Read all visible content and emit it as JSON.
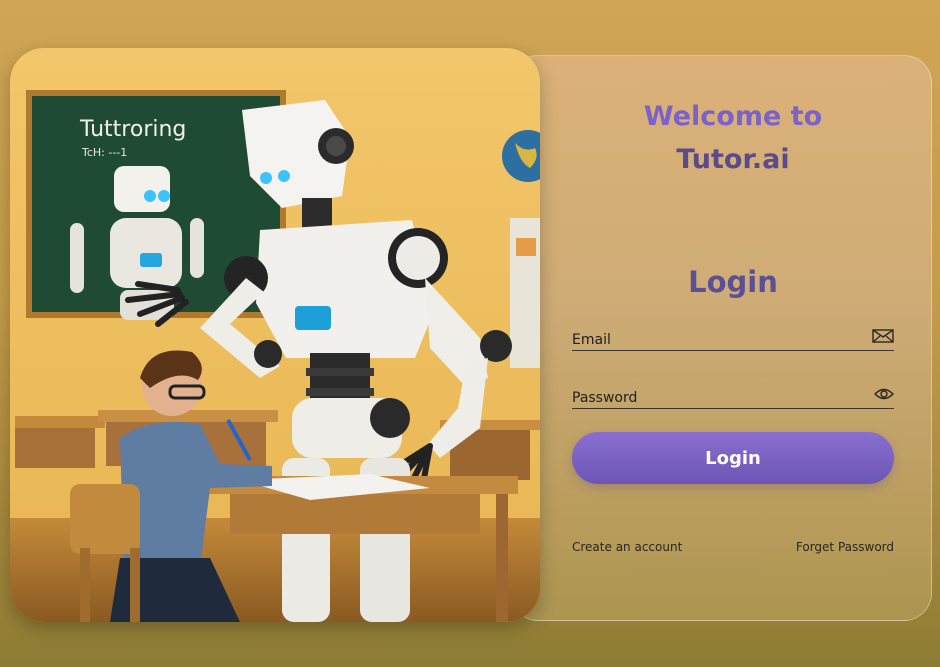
{
  "welcome": {
    "line1": "Welcome to",
    "line2": "Tutor.ai"
  },
  "hero": {
    "chalkboard_line1": "Tuttroring",
    "chalkboard_line2": "TcH: ---1"
  },
  "login": {
    "title": "Login",
    "email_label": "Email",
    "email_icon": "envelope-icon",
    "password_label": "Password",
    "password_icon": "eye-icon",
    "submit_label": "Login",
    "create_account": "Create an account",
    "forget_password": "Forget Password"
  },
  "colors": {
    "accent": "#7b62c9",
    "title": "#5b4f96",
    "background": "#c9a04e"
  }
}
